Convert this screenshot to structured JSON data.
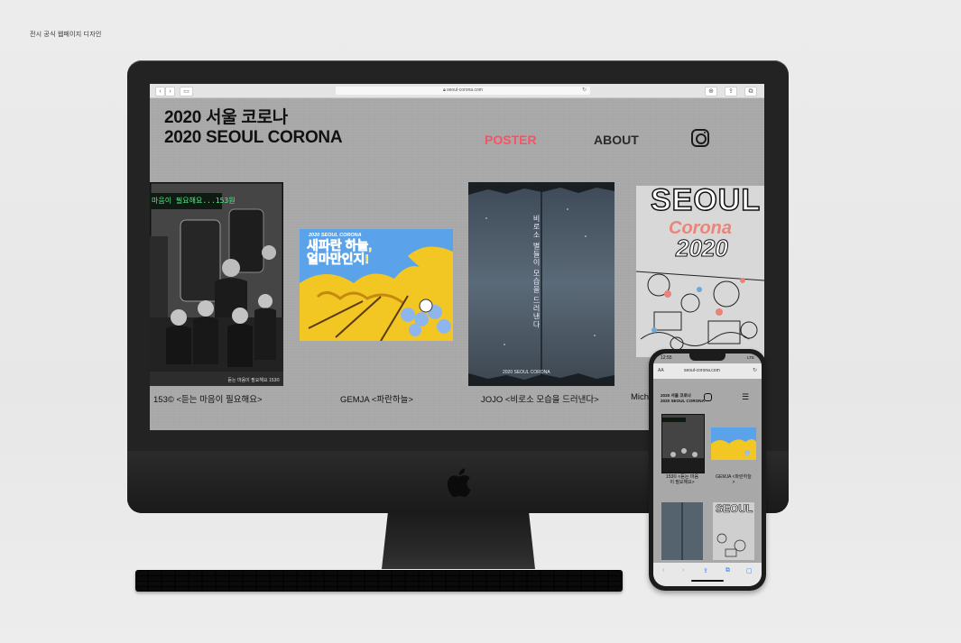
{
  "caption": "전시 공식 웹페이지 디자인",
  "browser": {
    "url": "seoul-corona.com",
    "back_icon": "chevron-left-icon",
    "forward_icon": "chevron-right-icon"
  },
  "site": {
    "title_ko": "2020 서울 코로나",
    "title_en": "2020 SEOUL CORONA",
    "nav": {
      "poster": "POSTER",
      "about": "ABOUT"
    },
    "accent_color": "#ff4f62"
  },
  "posters": [
    {
      "caption": "153© <듣는 마음이 필요해요>",
      "sign_text": "마음이 필요해요...153원",
      "footer_text": "듣는 마음이 필요해요 153©"
    },
    {
      "caption": "GEMJA <파란하늘>",
      "header_text": "2020 SEOUL CORONA",
      "headline": "새파란 하늘,\n얼마만인지!"
    },
    {
      "caption": "JOJO <비로소 모습을 드러낸다>",
      "vertical_text": "비로소 별들이 모습을 드러낸다",
      "footer_text": "2020 SEOUL CORONA"
    },
    {
      "caption": "Mich",
      "logo_text_1": "SEOUL",
      "logo_text_2": "Corona",
      "logo_text_3": "2020"
    }
  ],
  "phone": {
    "time": "12:55",
    "status_right": "LTE",
    "aa": "AA",
    "url": "seoul-corona.com",
    "title_ko": "2020 서울 코로나",
    "title_en": "2020 SEOUL CORONA",
    "menu_icon": "☰",
    "captions": [
      "153© <듣는 마음\n이 필요해요>",
      "GEMJA <파란하늘\n>"
    ],
    "logo_text": "SEOUL"
  }
}
